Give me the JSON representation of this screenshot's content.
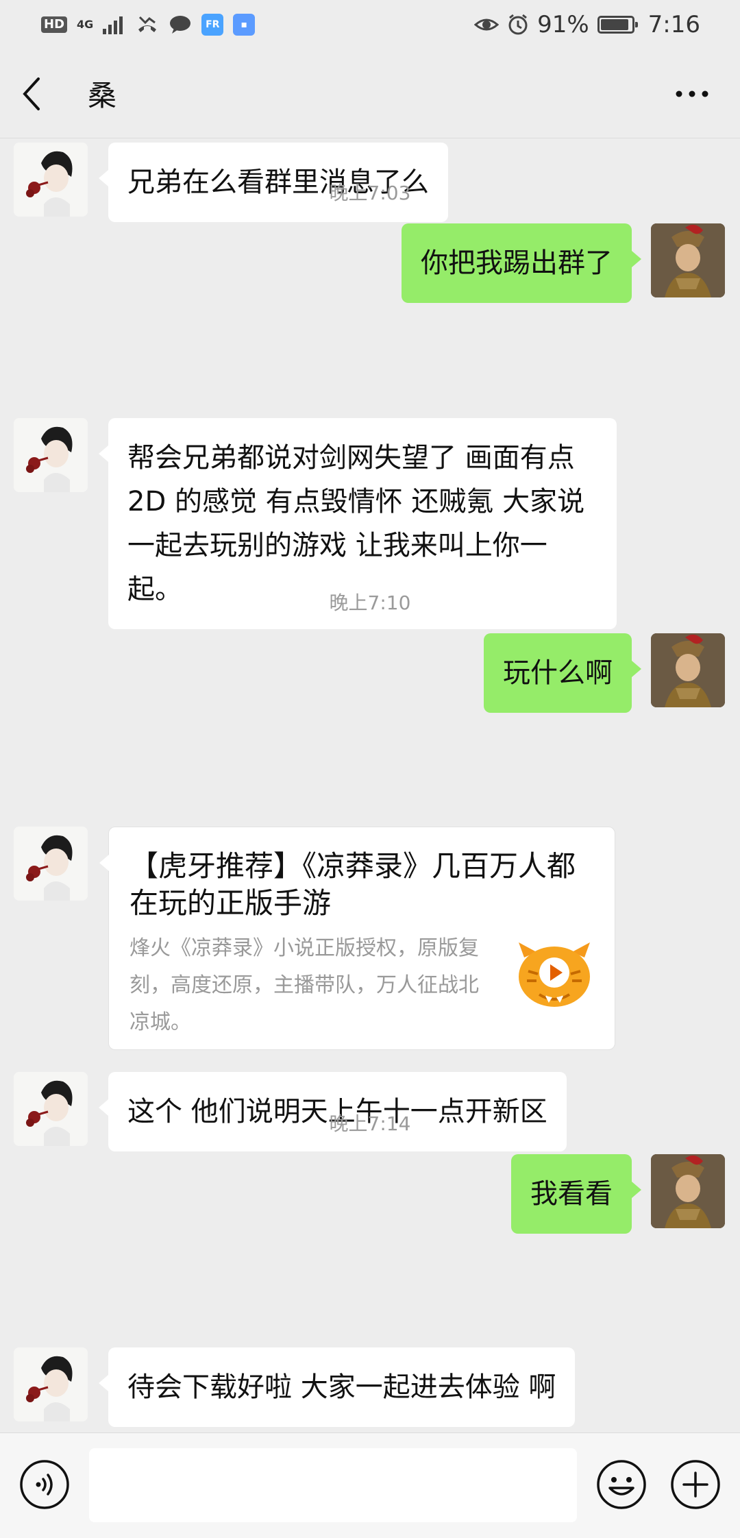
{
  "status_bar": {
    "hd": "HD",
    "network": "4G",
    "app1": "FR",
    "app2": "▪",
    "battery_percent": "91%",
    "battery_level": 0.91,
    "time": "7:16"
  },
  "nav": {
    "title": "桑",
    "back_icon": "chevron-left-icon",
    "more_icon": "more-dots-icon"
  },
  "messages": [
    {
      "type": "text",
      "side": "in",
      "text": "兄弟在么看群里消息了么"
    },
    {
      "type": "time",
      "text": "晚上7:03"
    },
    {
      "type": "text",
      "side": "out",
      "text": "你把我踢出群了"
    },
    {
      "type": "text",
      "side": "in",
      "text": "帮会兄弟都说对剑网失望了 画面有点 2D 的感觉  有点毁情怀  还贼氪 大家说一起去玩别的游戏 让我来叫上你一起。"
    },
    {
      "type": "time",
      "text": "晚上7:10"
    },
    {
      "type": "text",
      "side": "out",
      "text": "玩什么啊"
    },
    {
      "type": "card",
      "side": "in",
      "title": "【虎牙推荐】《凉莽录》几百万人都在玩的正版手游",
      "desc": "烽火《凉莽录》小说正版授权，原版复刻，高度还原，主播带队，万人征战北凉城。",
      "icon": "huya-tiger-icon"
    },
    {
      "type": "text",
      "side": "in",
      "text": "这个 他们说明天上午十一点开新区"
    },
    {
      "type": "time",
      "text": "晚上7:14"
    },
    {
      "type": "text",
      "side": "out",
      "text": "我看看"
    },
    {
      "type": "text",
      "side": "in",
      "text": "待会下载好啦 大家一起进去体验 啊"
    }
  ],
  "input_bar": {
    "voice_icon": "voice-icon",
    "input_value": "",
    "emoji_icon": "emoji-icon",
    "plus_icon": "plus-icon"
  },
  "colors": {
    "background": "#ededed",
    "outgoing_bubble": "#95ec69",
    "incoming_bubble": "#ffffff",
    "timestamp": "#9a9a9a"
  }
}
